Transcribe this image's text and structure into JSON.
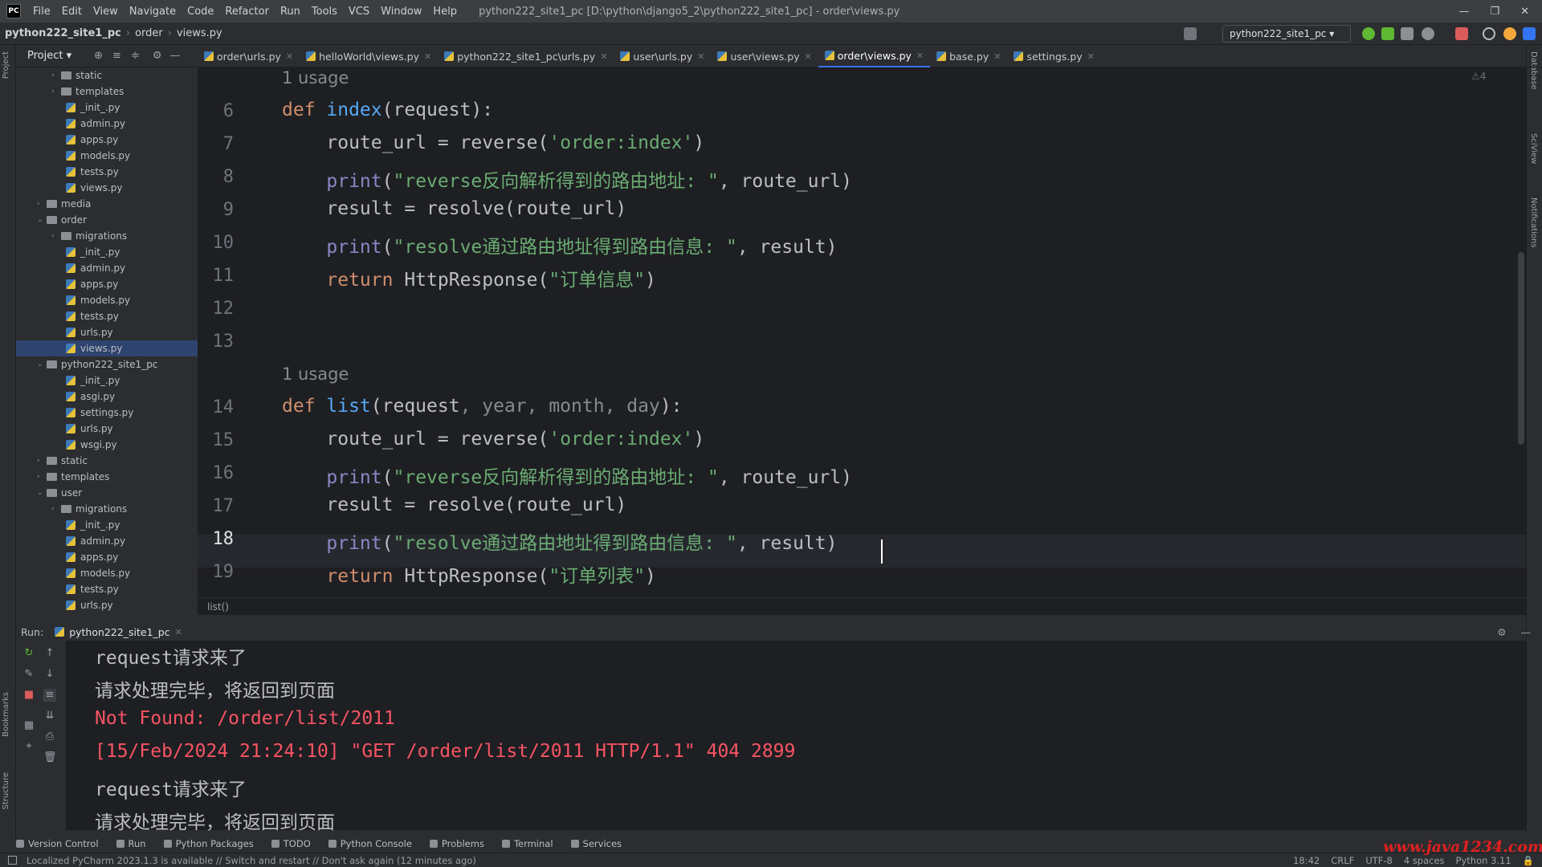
{
  "app": {
    "logo": "PC",
    "title": "python222_site1_pc [D:\\python\\django5_2\\python222_site1_pc] - order\\views.py"
  },
  "menu": [
    "File",
    "Edit",
    "View",
    "Navigate",
    "Code",
    "Refactor",
    "Run",
    "Tools",
    "VCS",
    "Window",
    "Help"
  ],
  "window_controls": [
    "—",
    "❐",
    "✕"
  ],
  "nav": {
    "project": "python222_site1_pc",
    "folder": "order",
    "file": "views.py",
    "run_config": "python222_site1_pc ▾"
  },
  "sidebar_labels": {
    "project": "Project",
    "bookmarks": "Bookmarks",
    "structure": "Structure",
    "database": "Database",
    "sciview": "SciView",
    "notifications": "Notifications"
  },
  "project_panel": {
    "title": "Project ▾"
  },
  "tree": [
    {
      "label": "static",
      "type": "folder",
      "depth": 2,
      "arrow": "›"
    },
    {
      "label": "templates",
      "type": "folder",
      "depth": 2,
      "arrow": "›"
    },
    {
      "label": "_init_.py",
      "type": "py",
      "depth": 3
    },
    {
      "label": "admin.py",
      "type": "py",
      "depth": 3
    },
    {
      "label": "apps.py",
      "type": "py",
      "depth": 3
    },
    {
      "label": "models.py",
      "type": "py",
      "depth": 3
    },
    {
      "label": "tests.py",
      "type": "py",
      "depth": 3
    },
    {
      "label": "views.py",
      "type": "py",
      "depth": 3
    },
    {
      "label": "media",
      "type": "folder",
      "depth": 1,
      "arrow": "›"
    },
    {
      "label": "order",
      "type": "folder",
      "depth": 1,
      "arrow": "⌄"
    },
    {
      "label": "migrations",
      "type": "folder",
      "depth": 2,
      "arrow": "›"
    },
    {
      "label": "_init_.py",
      "type": "py",
      "depth": 3
    },
    {
      "label": "admin.py",
      "type": "py",
      "depth": 3
    },
    {
      "label": "apps.py",
      "type": "py",
      "depth": 3
    },
    {
      "label": "models.py",
      "type": "py",
      "depth": 3
    },
    {
      "label": "tests.py",
      "type": "py",
      "depth": 3
    },
    {
      "label": "urls.py",
      "type": "py",
      "depth": 3
    },
    {
      "label": "views.py",
      "type": "py",
      "depth": 3,
      "selected": true
    },
    {
      "label": "python222_site1_pc",
      "type": "folder",
      "depth": 1,
      "arrow": "⌄"
    },
    {
      "label": "_init_.py",
      "type": "py",
      "depth": 3
    },
    {
      "label": "asgi.py",
      "type": "py",
      "depth": 3
    },
    {
      "label": "settings.py",
      "type": "py",
      "depth": 3
    },
    {
      "label": "urls.py",
      "type": "py",
      "depth": 3
    },
    {
      "label": "wsgi.py",
      "type": "py",
      "depth": 3
    },
    {
      "label": "static",
      "type": "folder",
      "depth": 1,
      "arrow": "›"
    },
    {
      "label": "templates",
      "type": "folder",
      "depth": 1,
      "arrow": "›"
    },
    {
      "label": "user",
      "type": "folder",
      "depth": 1,
      "arrow": "⌄"
    },
    {
      "label": "migrations",
      "type": "folder",
      "depth": 2,
      "arrow": "›"
    },
    {
      "label": "_init_.py",
      "type": "py",
      "depth": 3
    },
    {
      "label": "admin.py",
      "type": "py",
      "depth": 3
    },
    {
      "label": "apps.py",
      "type": "py",
      "depth": 3
    },
    {
      "label": "models.py",
      "type": "py",
      "depth": 3
    },
    {
      "label": "tests.py",
      "type": "py",
      "depth": 3
    },
    {
      "label": "urls.py",
      "type": "py",
      "depth": 3
    }
  ],
  "tabs": [
    {
      "label": "order\\urls.py"
    },
    {
      "label": "helloWorld\\views.py"
    },
    {
      "label": "python222_site1_pc\\urls.py"
    },
    {
      "label": "user\\urls.py"
    },
    {
      "label": "user\\views.py"
    },
    {
      "label": "order\\views.py",
      "active": true
    },
    {
      "label": "base.py"
    },
    {
      "label": "settings.py"
    }
  ],
  "editor": {
    "warnings": "⚠4",
    "usage_hint": "1 usage",
    "lines": [
      {
        "n": "6",
        "tokens": [
          [
            "kw",
            "def "
          ],
          [
            "fn",
            "index"
          ],
          [
            "",
            "(request):"
          ]
        ]
      },
      {
        "n": "7",
        "tokens": [
          [
            "",
            "    route_url = reverse("
          ],
          [
            "st",
            "'order:index'"
          ],
          [
            "",
            ")"
          ]
        ]
      },
      {
        "n": "8",
        "tokens": [
          [
            "",
            "    "
          ],
          [
            "bi",
            "print"
          ],
          [
            "",
            "("
          ],
          [
            "st",
            "\"reverse反向解析得到的路由地址: \""
          ],
          [
            "",
            ", route_url)"
          ]
        ]
      },
      {
        "n": "9",
        "tokens": [
          [
            "",
            "    result = resolve(route_url)"
          ]
        ]
      },
      {
        "n": "10",
        "tokens": [
          [
            "",
            "    "
          ],
          [
            "bi",
            "print"
          ],
          [
            "",
            "("
          ],
          [
            "st",
            "\"resolve通过路由地址得到路由信息: \""
          ],
          [
            "",
            ", result)"
          ]
        ]
      },
      {
        "n": "11",
        "tokens": [
          [
            "",
            "    "
          ],
          [
            "kw",
            "return "
          ],
          [
            "",
            "HttpResponse("
          ],
          [
            "st",
            "\"订单信息\""
          ],
          [
            "",
            ")"
          ]
        ]
      },
      {
        "n": "12",
        "tokens": []
      },
      {
        "n": "13",
        "tokens": []
      },
      {
        "n": "14",
        "tokens": [
          [
            "kw",
            "def "
          ],
          [
            "fn",
            "list"
          ],
          [
            "",
            "(request"
          ],
          [
            "pm",
            ", year, month, day"
          ],
          [
            "",
            "):"
          ]
        ]
      },
      {
        "n": "15",
        "tokens": [
          [
            "",
            "    route_url = reverse("
          ],
          [
            "st",
            "'order:index'"
          ],
          [
            "",
            ")"
          ]
        ]
      },
      {
        "n": "16",
        "tokens": [
          [
            "",
            "    "
          ],
          [
            "bi",
            "print"
          ],
          [
            "",
            "("
          ],
          [
            "st",
            "\"reverse反向解析得到的路由地址: \""
          ],
          [
            "",
            ", route_url)"
          ]
        ]
      },
      {
        "n": "17",
        "tokens": [
          [
            "",
            "    result = resolve(route_url)"
          ]
        ]
      },
      {
        "n": "18",
        "tokens": [
          [
            "",
            "    "
          ],
          [
            "bi",
            "print"
          ],
          [
            "",
            "("
          ],
          [
            "st",
            "\"resolve通过路由地址得到路由信息: \""
          ],
          [
            "",
            ", result)"
          ]
        ]
      },
      {
        "n": "19",
        "tokens": [
          [
            "",
            "    "
          ],
          [
            "kw",
            "return "
          ],
          [
            "",
            "HttpResponse("
          ],
          [
            "st",
            "\"订单列表\""
          ],
          [
            "",
            ")"
          ]
        ]
      }
    ],
    "breadcrumb": "list()"
  },
  "run": {
    "label": "Run:",
    "tab": "python222_site1_pc",
    "output": [
      {
        "text": "request请求来了",
        "error": false
      },
      {
        "text": "请求处理完毕，将返回到页面",
        "error": false
      },
      {
        "text": "Not Found: /order/list/2011",
        "error": true
      },
      {
        "text": "[15/Feb/2024 21:24:10] \"GET /order/list/2011 HTTP/1.1\" 404 2899",
        "error": true
      },
      {
        "text": "request请求来了",
        "error": false
      },
      {
        "text": "请求处理完毕，将返回到页面",
        "error": false
      }
    ]
  },
  "toolwindows": [
    "Version Control",
    "Run",
    "Python Packages",
    "TODO",
    "Python Console",
    "Problems",
    "Terminal",
    "Services"
  ],
  "status": {
    "message": "Localized PyCharm 2023.1.3 is available // Switch and restart // Don't ask again (12 minutes ago)",
    "position": "18:42",
    "line_sep": "CRLF",
    "encoding": "UTF-8",
    "indent": "4 spaces",
    "interpreter": "Python 3.11"
  },
  "watermark": "www.java1234.com"
}
